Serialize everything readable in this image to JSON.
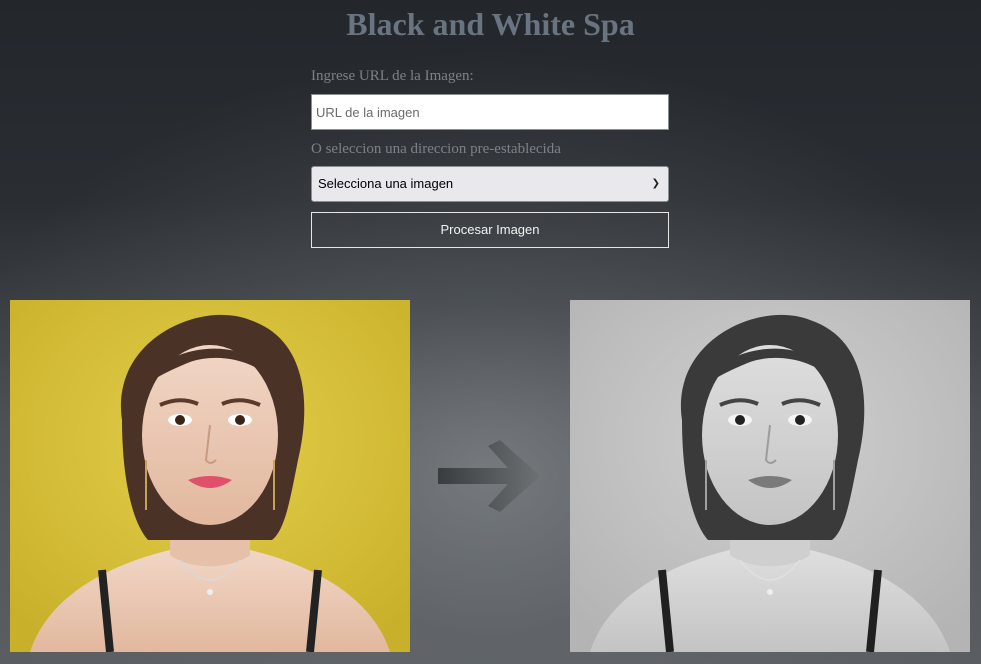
{
  "header": {
    "title": "Black and White Spa"
  },
  "form": {
    "url_label": "Ingrese URL de la Imagen:",
    "url_placeholder": "URL de la imagen",
    "url_value": "",
    "preset_label": "O seleccion una direccion pre-establecida",
    "preset_selected": "Selecciona una imagen",
    "process_button_label": "Procesar Imagen"
  },
  "images": {
    "original_icon": "portrait-photo-color",
    "processed_icon": "portrait-photo-grayscale",
    "arrow_icon": "right-arrow-icon"
  },
  "colors": {
    "background": "#23272c",
    "title": "#6a7480",
    "label": "#7c8288",
    "button_border": "#e6e6e6",
    "original_bg": "#d8c23a",
    "processed_bg": "#c4c4c4"
  }
}
